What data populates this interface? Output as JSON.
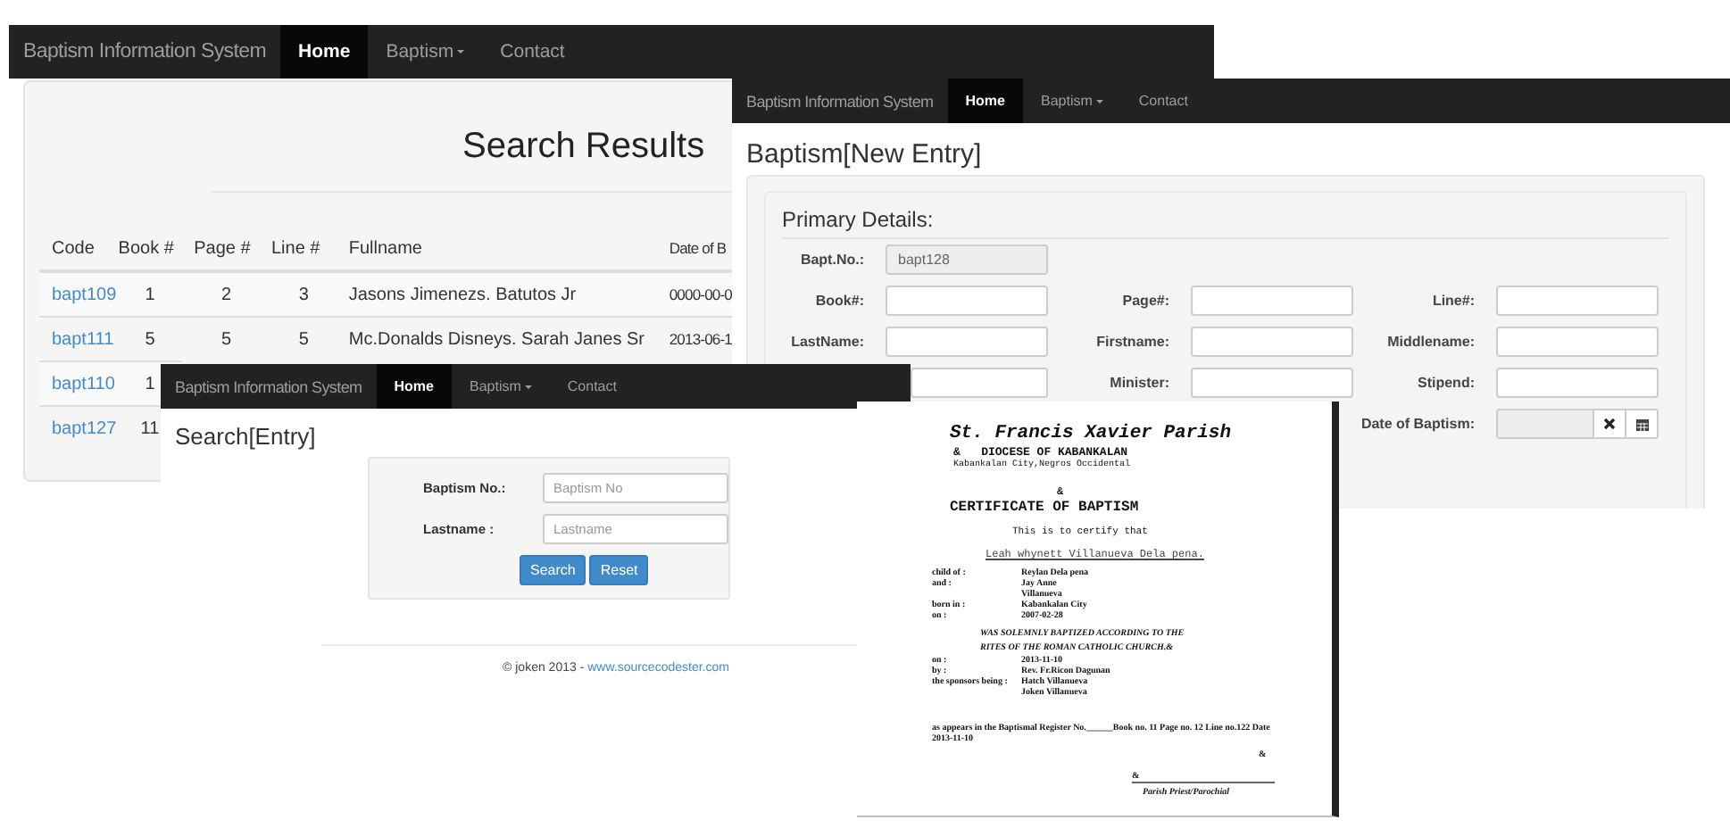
{
  "windows": [
    {
      "kind": "results",
      "nav": {
        "brand": "Baptism Information System",
        "items": [
          {
            "label": "Home",
            "selected": true,
            "dropdown": false
          },
          {
            "label": "Baptism",
            "selected": false,
            "dropdown": true
          },
          {
            "label": "Contact",
            "selected": false,
            "dropdown": false
          }
        ]
      },
      "heading": "Search Results",
      "table": {
        "columns": [
          "Code",
          "Book #",
          "Page #",
          "Line #",
          "Fullname",
          "Date of B"
        ],
        "rows": [
          {
            "cells": [
              "bapt109",
              "1",
              "2",
              "3",
              "Jasons Jimenezs. Batutos Jr",
              "0000-00-0"
            ]
          },
          {
            "cells": [
              "bapt111",
              "5",
              "5",
              "5",
              "Mc.Donalds Disneys. Sarah Janes Sr",
              "2013-06-1"
            ]
          },
          {
            "cells": [
              "bapt110",
              "1"
            ]
          },
          {
            "cells": [
              "bapt127",
              "11"
            ]
          }
        ]
      }
    },
    {
      "kind": "new_entry",
      "nav": {
        "brand": "Baptism Information System",
        "items": [
          {
            "label": "Home",
            "selected": true,
            "dropdown": false
          },
          {
            "label": "Baptism",
            "selected": false,
            "dropdown": true
          },
          {
            "label": "Contact",
            "selected": false,
            "dropdown": false
          }
        ]
      },
      "heading": "Baptism[New Entry]",
      "section": "Primary Details:",
      "fields": [
        {
          "kind": "text",
          "label": "Bapt.No.:",
          "value": "bapt128",
          "disabled": true
        },
        {
          "kind": "blank"
        },
        {
          "kind": "blank"
        },
        {
          "kind": "text",
          "label": "Book#:",
          "disabled": false
        },
        {
          "kind": "text",
          "label": "Page#:",
          "disabled": false
        },
        {
          "kind": "text",
          "label": "Line#:",
          "disabled": false
        },
        {
          "kind": "text",
          "label": "LastName:",
          "disabled": false
        },
        {
          "kind": "text",
          "label": "Firstname:",
          "disabled": false
        },
        {
          "kind": "text",
          "label": "Middlename:",
          "disabled": false
        },
        {
          "kind": "text",
          "disabled": false
        },
        {
          "kind": "text",
          "label": "Minister:",
          "disabled": false
        },
        {
          "kind": "text",
          "label": "Stipend:",
          "disabled": false
        },
        {
          "kind": "blank"
        },
        {
          "kind": "blank"
        },
        {
          "kind": "date",
          "label": "Date of Baptism:",
          "disabled": true
        }
      ]
    },
    {
      "kind": "search",
      "nav": {
        "brand": "Baptism Information System",
        "items": [
          {
            "label": "Home",
            "selected": true,
            "dropdown": false
          },
          {
            "label": "Baptism",
            "selected": false,
            "dropdown": true
          },
          {
            "label": "Contact",
            "selected": false,
            "dropdown": false
          }
        ]
      },
      "heading": "Search[Entry]",
      "fields": [
        {
          "label": "Baptism No.:",
          "placeholder": "Baptism No"
        },
        {
          "label": "Lastname :",
          "placeholder": "Lastname"
        }
      ],
      "buttons": [
        "Search",
        "Reset"
      ],
      "footer": {
        "text": "© joken 2013 - ",
        "link": "www.sourcecodester.com"
      }
    },
    {
      "kind": "certificate",
      "parish": "St. Francis Xavier Parish",
      "diocese": "&   DIOCESE OF KABANKALAN",
      "address": "Kabankalan City,Negros Occidental",
      "mark": "&",
      "title": "CERTIFICATE OF BAPTISM",
      "intro": "This is to certify that",
      "name": "Leah whynett Villanueva Dela pena.",
      "details": [
        {
          "label": "child of :",
          "value": "Reylan Dela pena"
        },
        {
          "label": "and :",
          "value": "Jay Anne"
        },
        {
          "value": "Villanueva"
        },
        {
          "label": "born in :",
          "value": "Kabankalan City"
        },
        {
          "label": "on :",
          "value": "2007-02-28"
        }
      ],
      "statement": [
        "WAS SOLEMNLY BAPTIZED ACCORDING TO THE",
        "RITES OF THE ROMAN CATHOLIC CHURCH.&"
      ],
      "rites": [
        {
          "label": "on :",
          "value": "2013-11-10"
        },
        {
          "label": "by :",
          "value": "Rev. Fr.Ricon Dagunan"
        },
        {
          "label": "the sponsors being :",
          "value": "Hatch Villanueva"
        },
        {
          "value": "Joken Villanueva"
        }
      ],
      "register": "as appears in the Baptismal Register No.______Book no. 11 Page no. 12 Line no.122 Date",
      "register_date": "2013-11-10",
      "signature_marks": [
        "&",
        "&"
      ],
      "signatory": "Parish Priest/Parochial"
    }
  ]
}
